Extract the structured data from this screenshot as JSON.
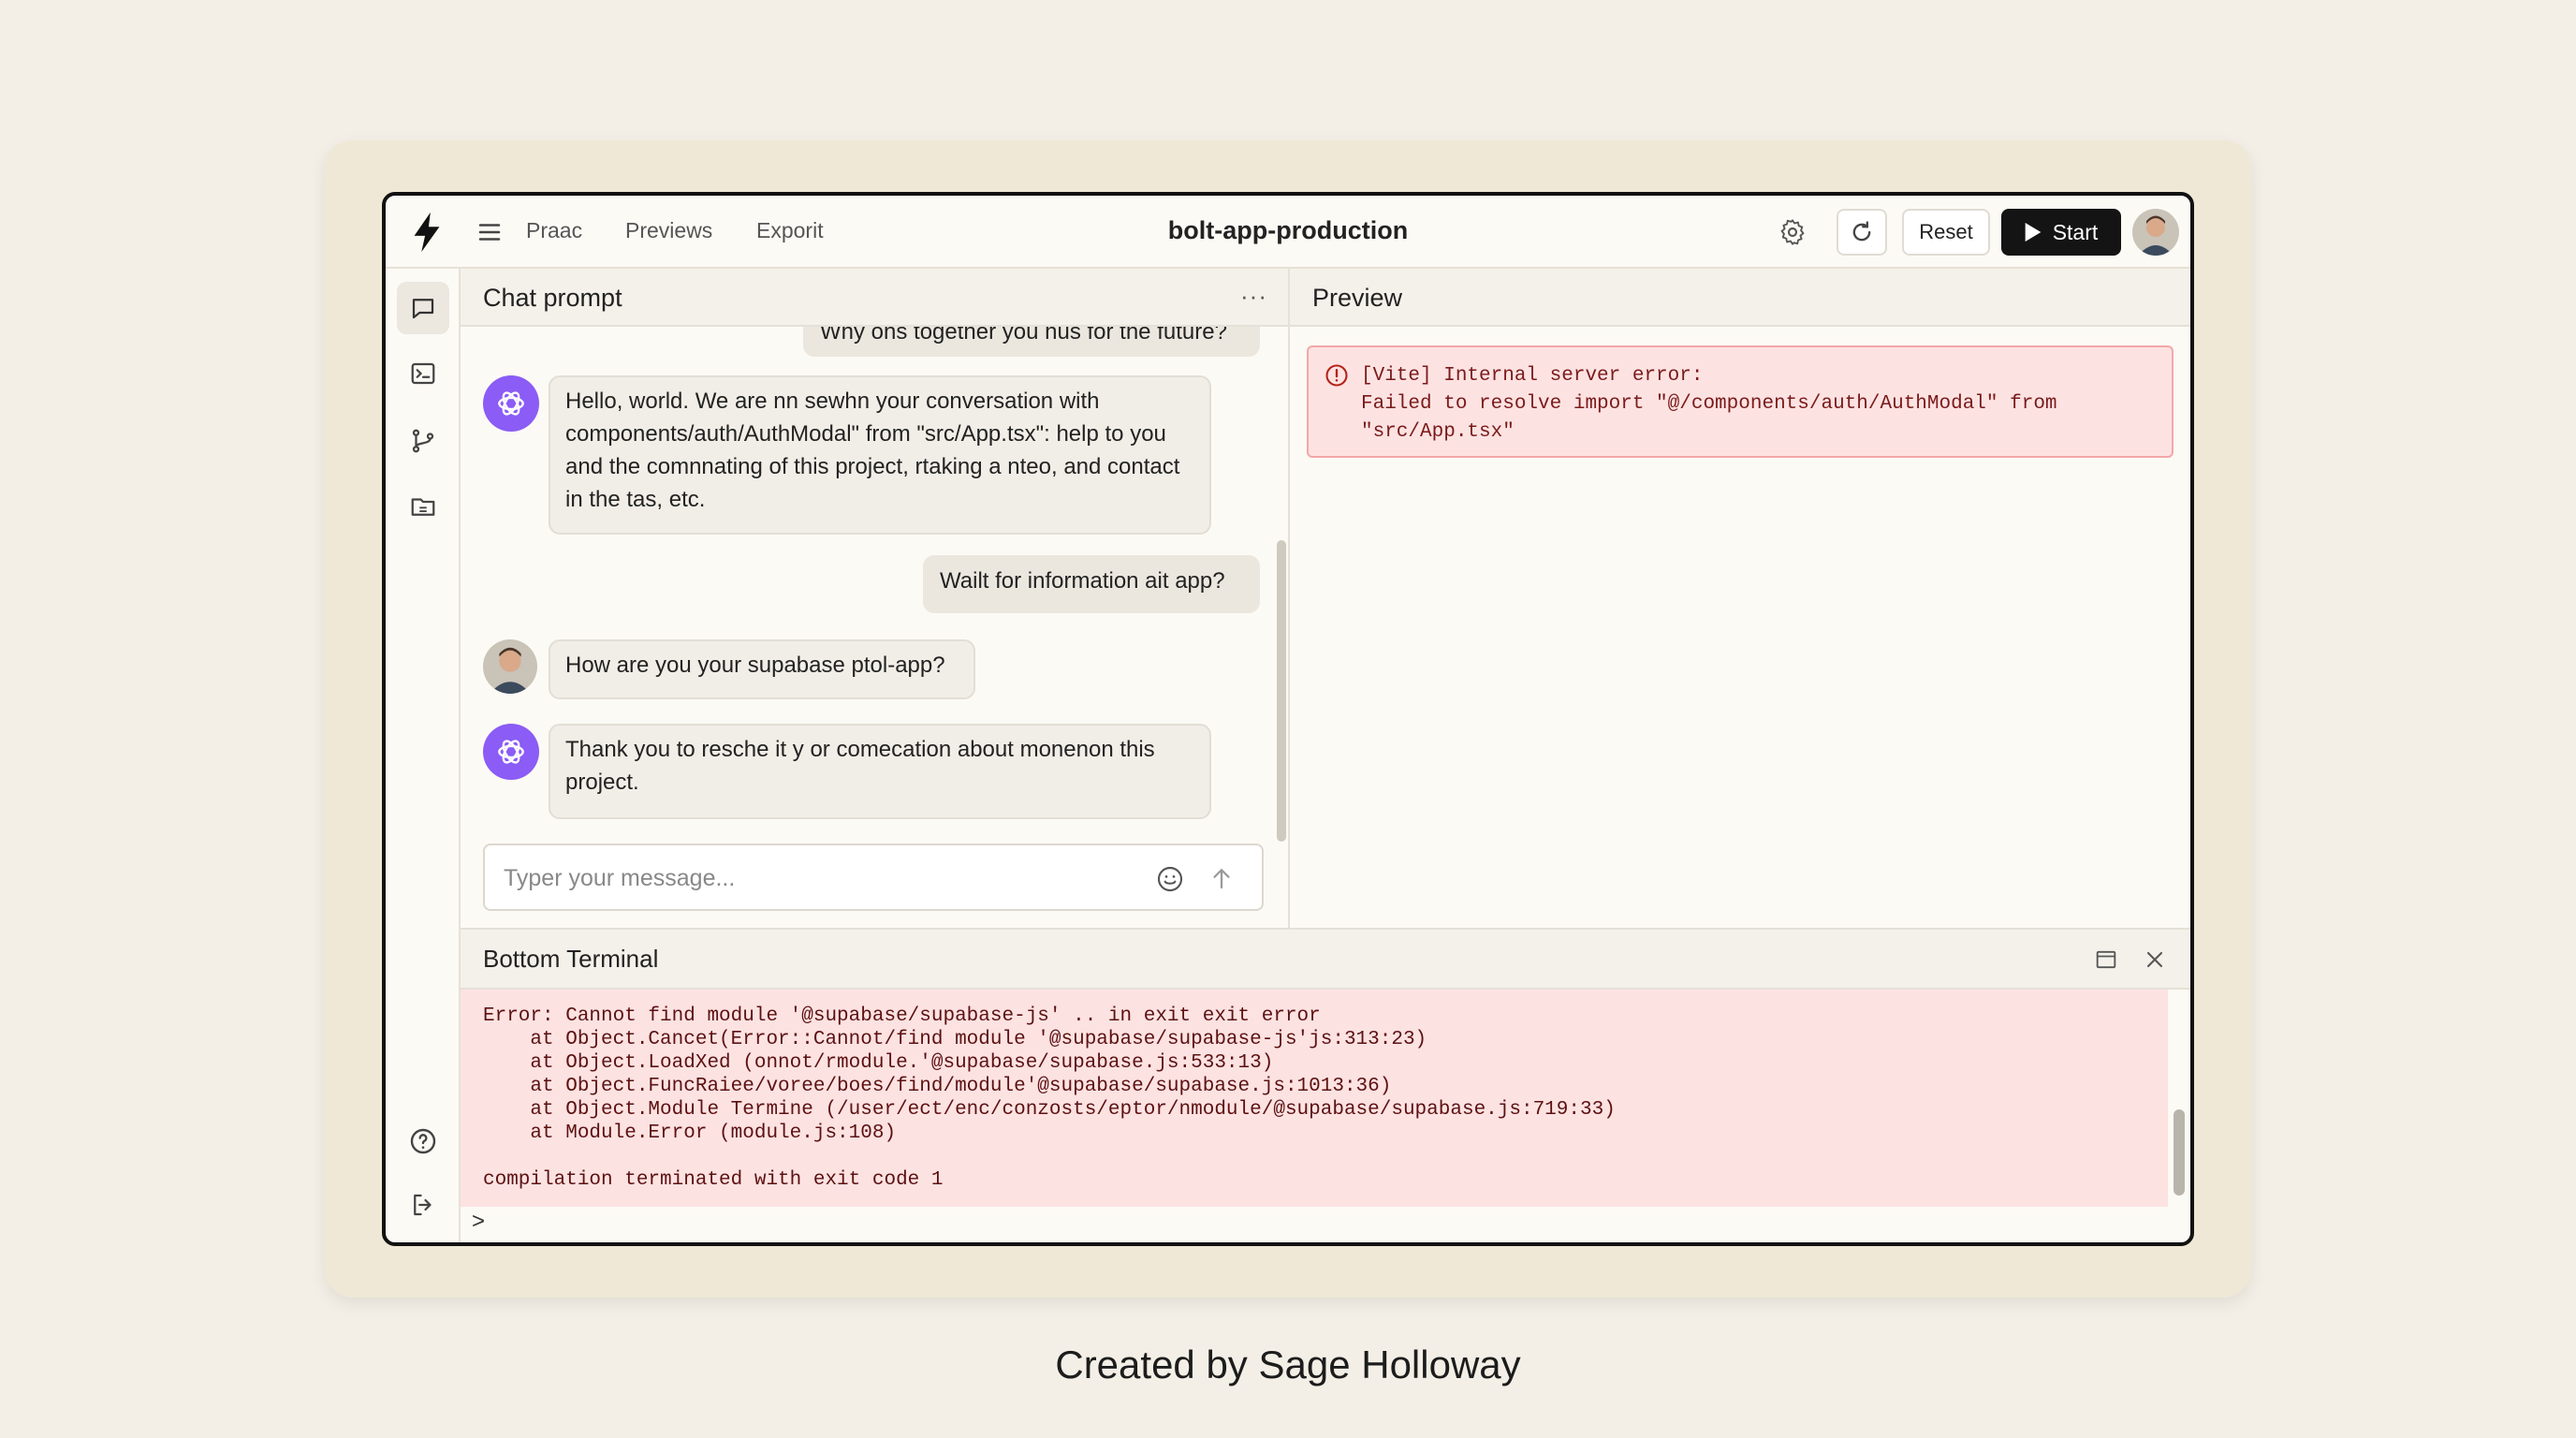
{
  "app": {
    "title": "bolt-app-production",
    "nav": [
      "Praac",
      "Previews",
      "Exporit"
    ],
    "reset_label": "Reset",
    "start_label": "Start"
  },
  "chat": {
    "title": "Chat prompt",
    "more": "···",
    "messages": [
      {
        "role": "user",
        "text": "Why ons together you hus for the future?"
      },
      {
        "role": "bot",
        "text": "Hello, world. We are nn sewhn your conversation with components/auth/AuthModal\" from \"src/App.tsx\": help to you and the comnnating of this project, rtaking a nteo, and contact in the tas, etc."
      },
      {
        "role": "user",
        "text": "Wailt for information ait app?"
      },
      {
        "role": "user-avatar",
        "text": "How are you your supabase ptol-app?"
      },
      {
        "role": "bot",
        "text": "Thank you to resche it y or comecation about monenon this project."
      }
    ],
    "input_placeholder": "Typer your message..."
  },
  "preview": {
    "title": "Preview",
    "error_text": "[Vite] Internal server error:\nFailed to resolve import \"@/components/auth/AuthModal\" from\n\"src/App.tsx\""
  },
  "terminal": {
    "title": "Bottom Terminal",
    "output": "Error: Cannot find module '@supabase/supabase-js' .. in exit exit error\n    at Object.Cancet(Error::Cannot/find module '@supabase/supabase-js'js:313:23)\n    at Object.LoadXed (onnot/rmodule.'@supabase/supabase.js:533:13)\n    at Object.FuncRaiee/voree/boes/find/module'@supabase/supabase.js:1013:36)\n    at Object.Module Termine (/user/ect/enc/conzosts/eptor/nmodule/@supabase/supabase.js:719:33)\n    at Module.Error (module.js:108)\n\ncompilation terminated with exit code 1",
    "prompt": ">"
  },
  "caption": "Created by Sage Holloway",
  "colors": {
    "accent_dark": "#141414",
    "bot_avatar": "#8b5cf6",
    "error_bg": "#fde2e2",
    "error_text": "#7a1a1a"
  },
  "icons": [
    "bolt-logo",
    "menu-icon",
    "gear-icon",
    "refresh-icon",
    "play-icon",
    "chat-icon",
    "terminal-icon",
    "git-branch-icon",
    "folder-icon",
    "help-icon",
    "logout-icon",
    "emoji-icon",
    "send-arrow-icon",
    "maximize-icon",
    "close-icon",
    "error-circle-icon"
  ]
}
